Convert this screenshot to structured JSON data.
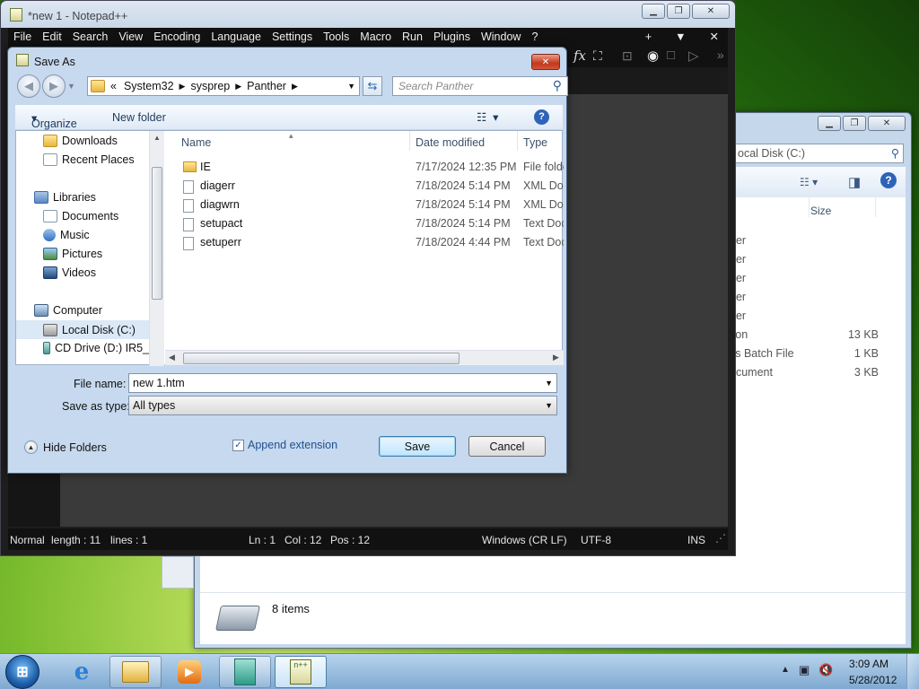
{
  "explorer": {
    "address_fragment": "ocal Disk (C:)",
    "column_size": "Size",
    "rows": [
      {
        "type": "der",
        "size": ""
      },
      {
        "type": "der",
        "size": ""
      },
      {
        "type": "der",
        "size": ""
      },
      {
        "type": "der",
        "size": ""
      },
      {
        "type": "der",
        "size": ""
      },
      {
        "type": "tion",
        "size": "13 KB"
      },
      {
        "type": "vs Batch File",
        "size": "1 KB"
      },
      {
        "type": "ocument",
        "size": "3 KB"
      }
    ],
    "items_count": "8 items"
  },
  "notepad": {
    "title": "*new 1 - Notepad++",
    "menu": [
      "File",
      "Edit",
      "Search",
      "View",
      "Encoding",
      "Language",
      "Settings",
      "Tools",
      "Macro",
      "Run",
      "Plugins",
      "Window",
      "?"
    ],
    "menu_right": [
      "+",
      "▼",
      "✕"
    ],
    "status": {
      "mode": "Normal",
      "length": "length : 11",
      "lines": "lines : 1",
      "ln": "Ln : 1",
      "col": "Col : 12",
      "pos": "Pos : 12",
      "eol": "Windows (CR LF)",
      "encoding": "UTF-8",
      "ins": "INS"
    }
  },
  "dialog": {
    "title": "Save As",
    "breadcrumb": [
      "«",
      "System32",
      "sysprep",
      "Panther"
    ],
    "search_placeholder": "Search Panther",
    "organize": "Organize",
    "new_folder": "New folder",
    "tree": [
      "Downloads",
      "Recent Places",
      "Libraries",
      "Documents",
      "Music",
      "Pictures",
      "Videos",
      "Computer",
      "Local Disk (C:)",
      "CD Drive (D:) IR5_"
    ],
    "columns": [
      "Name",
      "Date modified",
      "Type"
    ],
    "files": [
      {
        "name": "IE",
        "date": "7/17/2024 12:35 PM",
        "type": "File folder",
        "icon": "folder-icon"
      },
      {
        "name": "diagerr",
        "date": "7/18/2024 5:14 PM",
        "type": "XML Docu",
        "icon": "xml-file-icon"
      },
      {
        "name": "diagwrn",
        "date": "7/18/2024 5:14 PM",
        "type": "XML Docu",
        "icon": "xml-file-icon"
      },
      {
        "name": "setupact",
        "date": "7/18/2024 5:14 PM",
        "type": "Text Docu",
        "icon": "text-file-icon"
      },
      {
        "name": "setuperr",
        "date": "7/18/2024 4:44 PM",
        "type": "Text Docu",
        "icon": "text-file-icon"
      }
    ],
    "filename_label": "File name:",
    "filename_value": "new 1.htm",
    "savetype_label": "Save as type:",
    "savetype_value": "All types",
    "hide_folders": "Hide Folders",
    "append_extension": "Append extension",
    "save": "Save",
    "cancel": "Cancel"
  },
  "taskbar": {
    "time": "3:09 AM",
    "date": "5/28/2012"
  }
}
